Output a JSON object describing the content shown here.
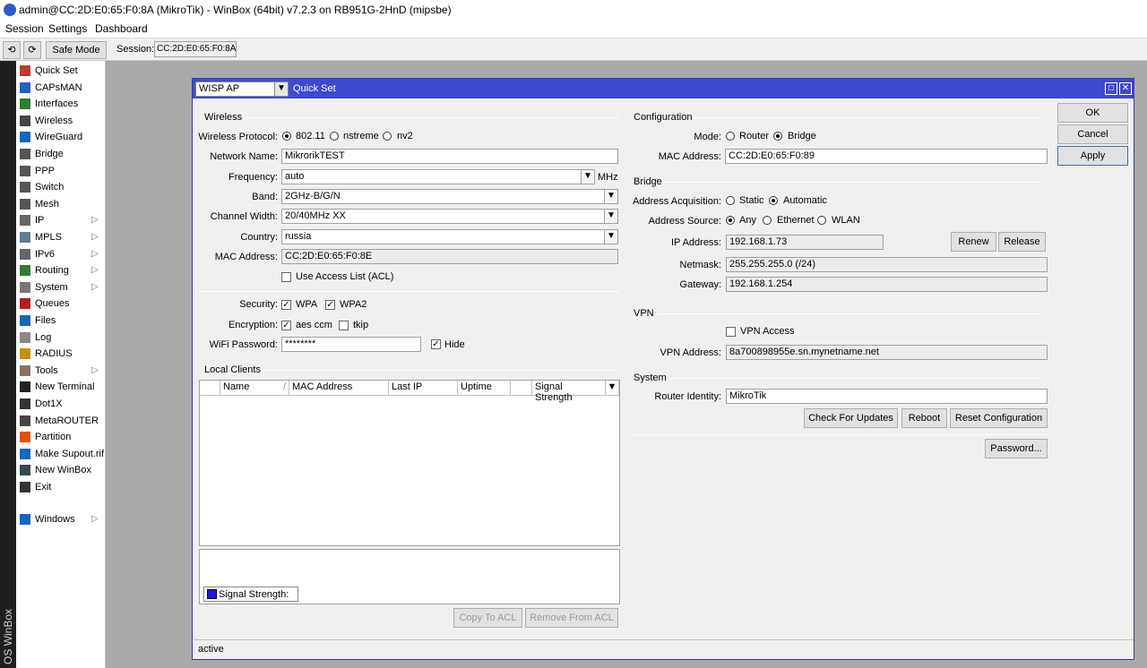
{
  "window": {
    "title": "admin@CC:2D:E0:65:F0:8A (MikroTik) - WinBox (64bit) v7.2.3 on RB951G-2HnD (mipsbe)"
  },
  "menu": [
    "Session",
    "Settings",
    "Dashboard"
  ],
  "toolbar": {
    "undo_icon": "undo-icon",
    "redo_icon": "redo-icon",
    "safe_mode": "Safe Mode",
    "session_label": "Session:",
    "session_value": "CC:2D:E0:65:F0:8A"
  },
  "brand": "OS WinBox",
  "sidebar": {
    "items": [
      {
        "label": "Quick Set",
        "icon": "quick-set-icon",
        "color": "#c0392b"
      },
      {
        "label": "CAPsMAN",
        "icon": "capsman-icon",
        "color": "#2060c0"
      },
      {
        "label": "Interfaces",
        "icon": "interfaces-icon",
        "color": "#2e7d32"
      },
      {
        "label": "Wireless",
        "icon": "wireless-icon",
        "color": "#444444"
      },
      {
        "label": "WireGuard",
        "icon": "wireguard-icon",
        "color": "#1565c0"
      },
      {
        "label": "Bridge",
        "icon": "bridge-icon",
        "color": "#555555"
      },
      {
        "label": "PPP",
        "icon": "ppp-icon",
        "color": "#555555"
      },
      {
        "label": "Switch",
        "icon": "switch-icon",
        "color": "#555555"
      },
      {
        "label": "Mesh",
        "icon": "mesh-icon",
        "color": "#555555"
      },
      {
        "label": "IP",
        "icon": "ip-icon",
        "color": "#666666",
        "arrow": true
      },
      {
        "label": "MPLS",
        "icon": "mpls-icon",
        "color": "#607d8b",
        "arrow": true
      },
      {
        "label": "IPv6",
        "icon": "ipv6-icon",
        "color": "#666666",
        "arrow": true
      },
      {
        "label": "Routing",
        "icon": "routing-icon",
        "color": "#2e7d32",
        "arrow": true
      },
      {
        "label": "System",
        "icon": "system-icon",
        "color": "#777777",
        "arrow": true
      },
      {
        "label": "Queues",
        "icon": "queues-icon",
        "color": "#b71c1c"
      },
      {
        "label": "Files",
        "icon": "files-icon",
        "color": "#1565c0"
      },
      {
        "label": "Log",
        "icon": "log-icon",
        "color": "#888888"
      },
      {
        "label": "RADIUS",
        "icon": "radius-icon",
        "color": "#c79100"
      },
      {
        "label": "Tools",
        "icon": "tools-icon",
        "color": "#8d6e63",
        "arrow": true
      },
      {
        "label": "New Terminal",
        "icon": "terminal-icon",
        "color": "#222222"
      },
      {
        "label": "Dot1X",
        "icon": "dot1x-icon",
        "color": "#333333"
      },
      {
        "label": "MetaROUTER",
        "icon": "metarouter-icon",
        "color": "#444444"
      },
      {
        "label": "Partition",
        "icon": "partition-icon",
        "color": "#e65100"
      },
      {
        "label": "Make Supout.rif",
        "icon": "supout-icon",
        "color": "#1565c0"
      },
      {
        "label": "New WinBox",
        "icon": "winbox-icon",
        "color": "#37474f"
      },
      {
        "label": "Exit",
        "icon": "exit-icon",
        "color": "#333333"
      }
    ],
    "windows": {
      "label": "Windows",
      "icon": "windows-icon",
      "color": "#1565c0",
      "arrow": true
    }
  },
  "dialog": {
    "mode_select": "WISP AP",
    "title": "Quick Set",
    "wireless": {
      "section": "Wireless",
      "protocol_label": "Wireless Protocol:",
      "protocol_options": [
        "802.11",
        "nstreme",
        "nv2"
      ],
      "network_name_label": "Network Name:",
      "network_name": "MikrorikTEST",
      "frequency_label": "Frequency:",
      "frequency": "auto",
      "frequency_unit": "MHz",
      "band_label": "Band:",
      "band": "2GHz-B/G/N",
      "channel_width_label": "Channel Width:",
      "channel_width": "20/40MHz XX",
      "country_label": "Country:",
      "country": "russia",
      "mac_label": "MAC Address:",
      "mac": "CC:2D:E0:65:F0:8E",
      "acl_label": "Use Access List (ACL)",
      "security_label": "Security:",
      "wpa": "WPA",
      "wpa2": "WPA2",
      "encryption_label": "Encryption:",
      "aes": "aes ccm",
      "tkip": "tkip",
      "password_label": "WiFi Password:",
      "password": "********",
      "hide": "Hide"
    },
    "clients": {
      "section": "Local Clients",
      "columns": [
        "Name",
        "MAC Address",
        "Last IP",
        "Uptime",
        "Signal Strength"
      ],
      "legend": "Signal Strength:",
      "copy_acl": "Copy To ACL",
      "remove_acl": "Remove From ACL"
    },
    "configuration": {
      "section": "Configuration",
      "mode_label": "Mode:",
      "mode_router": "Router",
      "mode_bridge": "Bridge",
      "mac_label": "MAC Address:",
      "mac": "CC:2D:E0:65:F0:89"
    },
    "bridge": {
      "section": "Bridge",
      "acq_label": "Address Acquisition:",
      "acq_static": "Static",
      "acq_auto": "Automatic",
      "source_label": "Address Source:",
      "src_any": "Any",
      "src_eth": "Ethernet",
      "src_wlan": "WLAN",
      "ip_label": "IP Address:",
      "ip": "192.168.1.73",
      "renew": "Renew",
      "release": "Release",
      "netmask_label": "Netmask:",
      "netmask": "255.255.255.0 (/24)",
      "gateway_label": "Gateway:",
      "gateway": "192.168.1.254"
    },
    "vpn": {
      "section": "VPN",
      "access_label": "VPN Access",
      "address_label": "VPN Address:",
      "address": "8a700898955e.sn.mynetname.net"
    },
    "system": {
      "section": "System",
      "identity_label": "Router Identity:",
      "identity": "MikroTik",
      "check_updates": "Check For Updates",
      "reboot": "Reboot",
      "reset": "Reset Configuration",
      "password": "Password..."
    },
    "buttons": {
      "ok": "OK",
      "cancel": "Cancel",
      "apply": "Apply"
    },
    "status": "active"
  }
}
